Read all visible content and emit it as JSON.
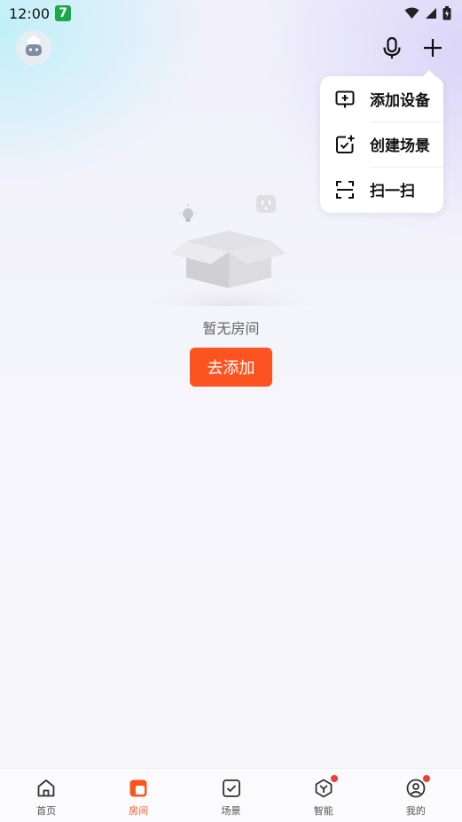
{
  "status_bar": {
    "time": "12:00",
    "app_badge": "7"
  },
  "menu": {
    "items": [
      {
        "label": "添加设备",
        "icon": "add-device-icon"
      },
      {
        "label": "创建场景",
        "icon": "create-scene-icon"
      },
      {
        "label": "扫一扫",
        "icon": "scan-icon"
      }
    ]
  },
  "empty_state": {
    "message": "暂无房间",
    "button": "去添加"
  },
  "tabs": [
    {
      "label": "首页",
      "icon": "home-icon",
      "active": false,
      "dot": false
    },
    {
      "label": "房间",
      "icon": "room-icon",
      "active": true,
      "dot": false
    },
    {
      "label": "场景",
      "icon": "scene-icon",
      "active": false,
      "dot": false
    },
    {
      "label": "智能",
      "icon": "smart-icon",
      "active": false,
      "dot": true
    },
    {
      "label": "我的",
      "icon": "profile-icon",
      "active": false,
      "dot": true
    }
  ],
  "colors": {
    "accent": "#fb5420",
    "badge": "#1aa84a",
    "dot": "#f23b3b"
  }
}
